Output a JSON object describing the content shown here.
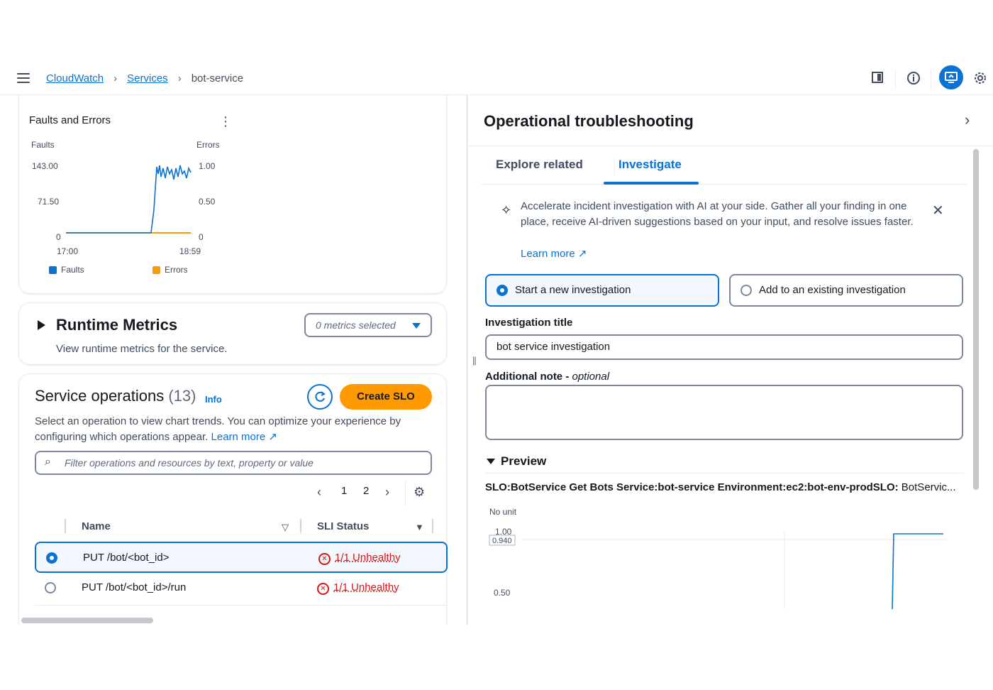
{
  "topbar": {
    "breadcrumbs": [
      "CloudWatch",
      "Services",
      "bot-service"
    ],
    "icons": [
      "panel-icon",
      "info-icon",
      "ai-assistant-icon",
      "settings-icon"
    ]
  },
  "faults_errors": {
    "title": "Faults and Errors",
    "left_axis_title": "Faults",
    "right_axis_title": "Errors",
    "left_ticks": [
      "143.00",
      "71.50",
      "0"
    ],
    "right_ticks": [
      "1.00",
      "0.50",
      "0"
    ],
    "x_ticks": [
      "17:00",
      "18:59"
    ],
    "legend": [
      {
        "label": "Faults",
        "color": "#0972d3"
      },
      {
        "label": "Errors",
        "color": "#ff9900"
      }
    ]
  },
  "runtime": {
    "title": "Runtime Metrics",
    "description": "View runtime metrics for the service.",
    "select_value": "0 metrics selected"
  },
  "ops": {
    "title": "Service operations",
    "count": "(13)",
    "info": "Info",
    "create_slo": "Create SLO",
    "description": "Select an operation to view chart trends. You can optimize your experience by configuring which operations appear.",
    "learn_more": "Learn more",
    "filter_placeholder": "Filter operations and resources by text, property or value",
    "pages": [
      "1",
      "2"
    ],
    "col_name": "Name",
    "col_status": "SLI Status",
    "rows": [
      {
        "name": "PUT /bot/<bot_id>",
        "status": "1/1 Unhealthy",
        "selected": true
      },
      {
        "name": "PUT /bot/<bot_id>/run",
        "status": "1/1 Unhealthy",
        "selected": false
      }
    ]
  },
  "panel": {
    "title": "Operational troubleshooting",
    "tabs": [
      "Explore related",
      "Investigate"
    ],
    "active_tab": "Investigate",
    "alert_text": "Accelerate incident investigation with AI at your side. Gather all your finding in one place, receive AI-driven suggestions based on your input, and resolve issues faster.",
    "alert_learn_more": "Learn more",
    "option_new": "Start a new investigation",
    "option_existing": "Add to an existing investigation",
    "title_label": "Investigation title",
    "title_value": "bot service investigation",
    "note_label": "Additional note",
    "note_optional": "optional",
    "preview_label": "Preview",
    "slo_prefix": "SLO:BotService Get Bots Service:bot-service Environment:ec2:bot-env-prodSLO:",
    "slo_suffix": "BotServic...",
    "no_unit": "No unit",
    "y_ticks": [
      "1.00",
      "0.940",
      "0.50"
    ]
  }
}
